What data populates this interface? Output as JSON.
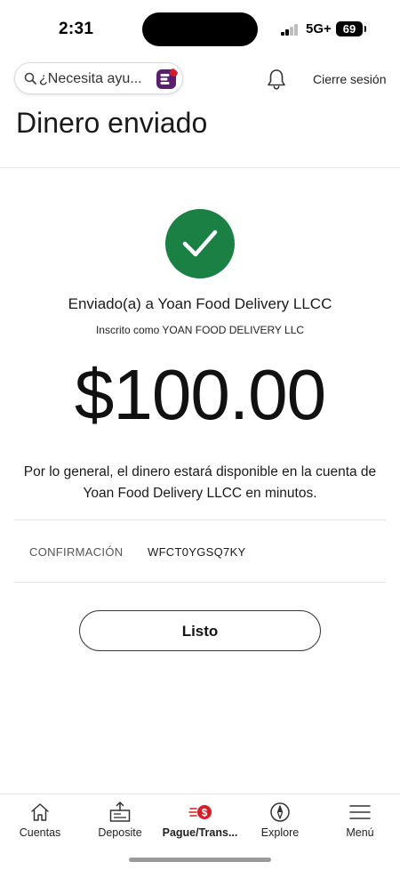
{
  "status_bar": {
    "time": "2:31",
    "network": "5G+",
    "battery": "69"
  },
  "header": {
    "search_placeholder": "¿Necesita ayu...",
    "sign_out_label": "Cierre sesión",
    "page_title": "Dinero enviado"
  },
  "confirmation": {
    "sent_to": "Enviado(a) a Yoan Food Delivery LLCC",
    "enrolled_as": "Inscrito como YOAN FOOD DELIVERY LLC",
    "amount": "$100.00",
    "availability_note": "Por lo general, el dinero estará disponible en la cuenta de Yoan Food Delivery LLCC en minutos.",
    "confirmation_label": "CONFIRMACIÓN",
    "confirmation_code": "WFCT0YGSQ7KY",
    "done_label": "Listo"
  },
  "bottom_nav": {
    "items": [
      {
        "label": "Cuentas",
        "icon": "home-icon"
      },
      {
        "label": "Deposite",
        "icon": "deposit-icon"
      },
      {
        "label": "Pague/Trans...",
        "icon": "pay-transfer-icon"
      },
      {
        "label": "Explore",
        "icon": "compass-icon"
      },
      {
        "label": "Menú",
        "icon": "menu-icon"
      }
    ],
    "active_index": 2
  },
  "colors": {
    "success_green": "#1a8044",
    "brand_red": "#d71e28",
    "assistant_purple": "#5a1e6e"
  }
}
